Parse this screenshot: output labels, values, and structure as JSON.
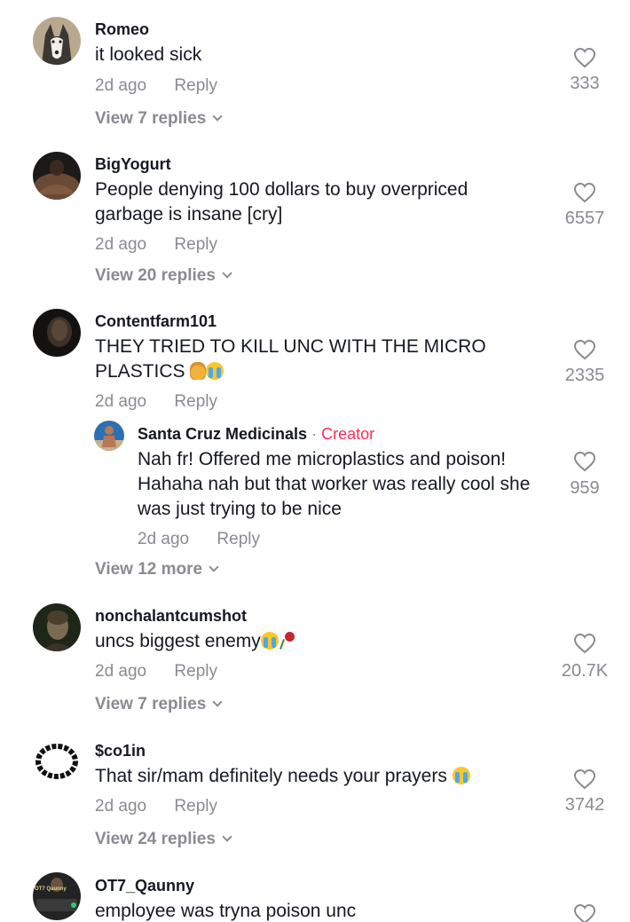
{
  "comments": [
    {
      "username": "Romeo",
      "text": "it looked sick",
      "time": "2d ago",
      "reply": "Reply",
      "likes": "333",
      "view_replies": "View 7 replies"
    },
    {
      "username": "BigYogurt",
      "text": "People denying 100 dollars to buy overpriced garbage is insane [cry]",
      "time": "2d ago",
      "reply": "Reply",
      "likes": "6557",
      "view_replies": "View 20 replies"
    },
    {
      "username": "Contentfarm101",
      "text": "THEY TRIED TO KILL UNC WITH THE MICRO PLASTICS",
      "time": "2d ago",
      "reply": "Reply",
      "likes": "2335",
      "nested_reply": {
        "username": "Santa Cruz Medicinals",
        "separator": "·",
        "badge": "Creator",
        "text": "Nah fr! Offered me microplastics and poison! Hahaha nah but that worker was really cool she was just trying to be nice",
        "time": "2d ago",
        "reply": "Reply",
        "likes": "959"
      },
      "view_replies": "View 12 more"
    },
    {
      "username": "nonchalantcumshot",
      "text": "uncs biggest enemy",
      "time": "2d ago",
      "reply": "Reply",
      "likes": "20.7K",
      "view_replies": "View 7 replies"
    },
    {
      "username": "$co1in",
      "text": "That sir/mam definitely needs your prayers",
      "time": "2d ago",
      "reply": "Reply",
      "likes": "3742",
      "view_replies": "View 24 replies"
    },
    {
      "username": "OT7_Qaunny",
      "avatar_text": "OT7 Qaunny",
      "text": "employee was tryna poison unc"
    }
  ],
  "colors": {
    "text": "#161823",
    "muted": "#8a8b91",
    "creator": "#fe2c55",
    "background": "#ffffff"
  },
  "icons": {
    "like": "heart-outline-icon",
    "expand": "chevron-down-icon"
  }
}
